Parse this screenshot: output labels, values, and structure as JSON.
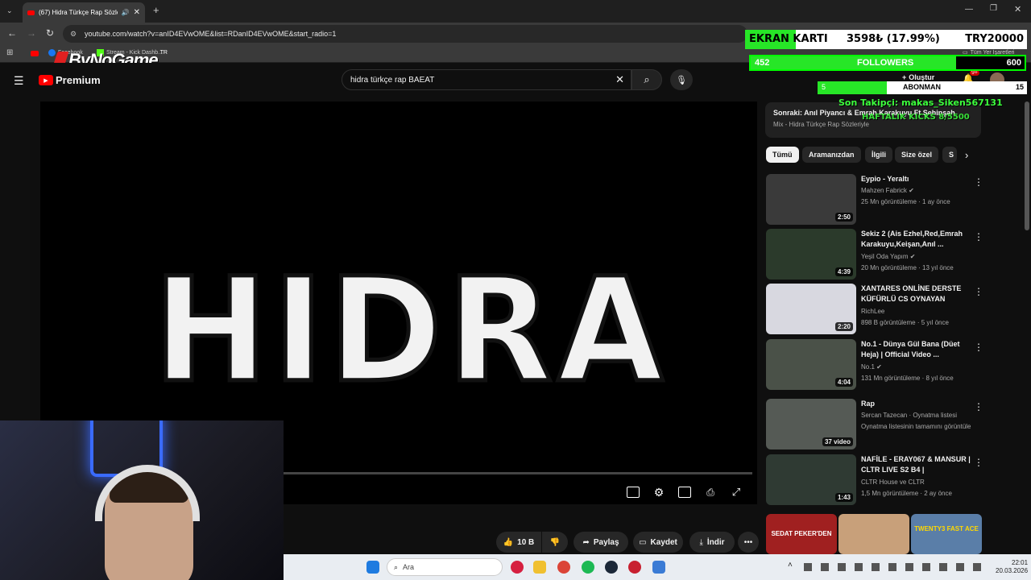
{
  "browser": {
    "tab_title": "(67) Hidra Türkçe Rap Sözle",
    "url": "youtube.com/watch?v=anID4EVwOME&list=RDanID4EVwOME&start_radio=1",
    "bookmarks": [
      "Facebook",
      "Stream - Kick Dashb...",
      "Tüm Yer İşaretleri"
    ]
  },
  "overlay_brand": {
    "logo": "ByNoGame",
    "logo_sub": "TR"
  },
  "youtube": {
    "logo": "Premium",
    "search_value": "hidra türkçe rap BAEAT",
    "create_label": "Oluştur",
    "notif_count": "9+"
  },
  "player": {
    "title_art": "HIDRA"
  },
  "actions": {
    "likes": "10 B",
    "share": "Paylaş",
    "save": "Kaydet",
    "download": "İndir"
  },
  "mix": {
    "next": "Sonraki: Anıl Piyancı & Emrah Karakuyu Ft Şehinşah",
    "sub": "Mix - Hidra Türkçe Rap Sözleriyle"
  },
  "chips": [
    "Tümü",
    "Aramanızdan",
    "İlgili",
    "Size özel",
    "S"
  ],
  "videos": [
    {
      "title": "Eypio - Yeraltı",
      "channel": "Mahzen Fabrick",
      "verified": true,
      "meta": "25 Mn görüntüleme · 1 ay önce",
      "duration": "2:50",
      "color": "#3a3a3a"
    },
    {
      "title": "Sekiz 2 (Ais Ezhel,Red,Emrah Karakuyu,Keişan,Anıl ...",
      "channel": "Yeşil Oda Yapım",
      "verified": true,
      "meta": "20 Mn görüntüleme · 13 yıl önce",
      "duration": "4:39",
      "color": "#2b3a2b"
    },
    {
      "title": "XANTARES ONLİNE DERSTE KÜFÜRLÜ CS OYNAYAN ÇOCU...",
      "channel": "RichLee",
      "verified": false,
      "meta": "898 B görüntüleme · 5 yıl önce",
      "duration": "2:20",
      "color": "#d8d8e0"
    },
    {
      "title": "No.1 - Dünya Gül Bana (Düet Heja) | Official Video ...",
      "channel": "No.1",
      "verified": true,
      "meta": "131 Mn görüntüleme · 8 yıl önce",
      "duration": "4:04",
      "color": "#4a5148"
    },
    {
      "title": "Rap",
      "channel": "Sercan Tazecan · Oynatma listesi",
      "verified": false,
      "meta": "Oynatma listesinin tamamını görüntüle",
      "duration": "37 video",
      "color": "#555a55"
    },
    {
      "title": "NAFİLE - ERAY067 & MANSUR | CLTR LIVE S2 B4 |",
      "channel": "CLTR House ve CLTR",
      "verified": false,
      "meta": "1,5 Mn görüntüleme · 2 ay önce",
      "duration": "1:43",
      "color": "#2f3a33"
    }
  ],
  "bottom_thumbs": [
    "SEDAT PEKER'DEN",
    "",
    "TWENTY3 FAST ACE"
  ],
  "stream_overlay": {
    "gpu_label": "EKRAN KARTI",
    "gpu_value": "3598₺ (17.99%)",
    "gpu_goal": "TRY20000",
    "followers_count": "452",
    "followers_label": "FOLLOWERS",
    "followers_goal": "600",
    "sub_count": "5",
    "sub_label": "ABONMAN",
    "sub_goal": "15",
    "last_follower": "Son Takipçi: makas_Siken567131",
    "weekly_kicks": "HAFTALIK KICKS 8/5500"
  },
  "taskbar": {
    "search_placeholder": "Ara",
    "time": "22:01",
    "date": "20.03.2026"
  }
}
